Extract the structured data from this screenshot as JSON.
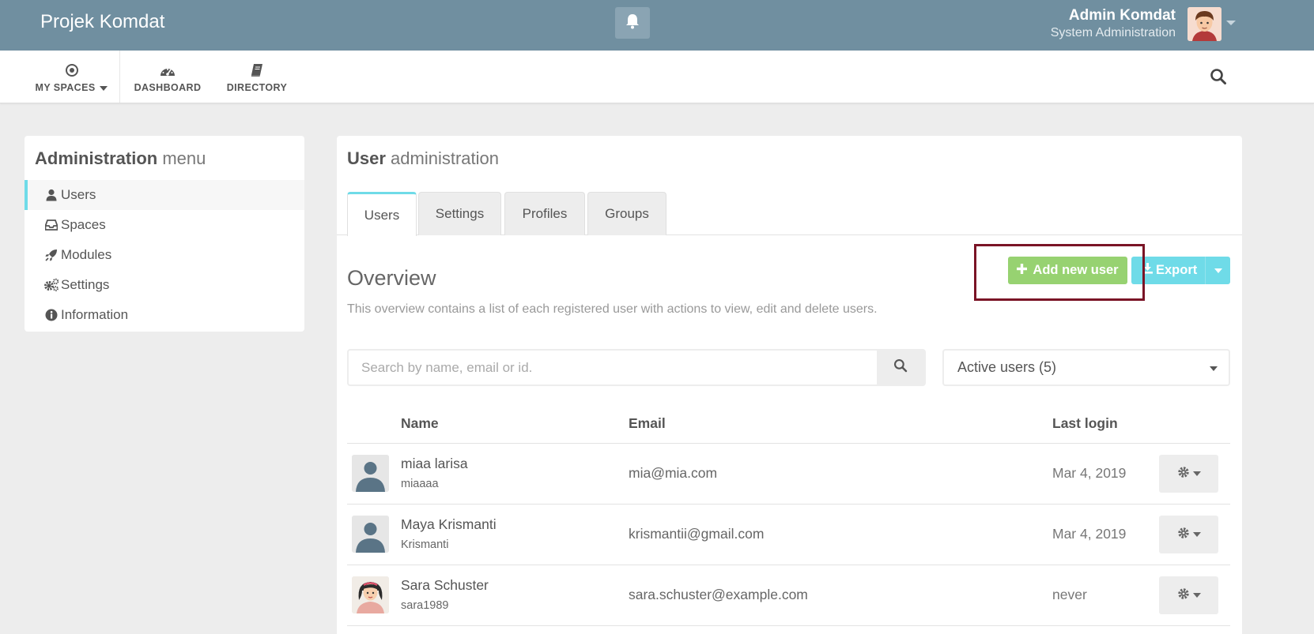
{
  "app": {
    "brand": "Projek Komdat"
  },
  "user": {
    "name": "Admin Komdat",
    "role": "System Administration"
  },
  "nav": {
    "my_spaces": "MY SPACES",
    "dashboard": "DASHBOARD",
    "directory": "DIRECTORY"
  },
  "admin_menu": {
    "title_bold": "Administration",
    "title_light": "menu",
    "items": [
      {
        "label": "Users",
        "icon": "user-icon",
        "active": true
      },
      {
        "label": "Spaces",
        "icon": "inbox-icon"
      },
      {
        "label": "Modules",
        "icon": "rocket-icon"
      },
      {
        "label": "Settings",
        "icon": "gears-icon"
      },
      {
        "label": "Information",
        "icon": "info-circle-icon"
      }
    ]
  },
  "main": {
    "title_bold": "User",
    "title_light": "administration",
    "tabs": [
      {
        "label": "Users",
        "active": true
      },
      {
        "label": "Settings"
      },
      {
        "label": "Profiles"
      },
      {
        "label": "Groups"
      }
    ],
    "overview_title": "Overview",
    "overview_desc": "This overview contains a list of each registered user with actions to view, edit and delete users.",
    "add_button": "Add new user",
    "export_button": "Export",
    "search_placeholder": "Search by name, email or id.",
    "filter_selected": "Active users (5)",
    "columns": {
      "name": "Name",
      "email": "Email",
      "last_login": "Last login"
    },
    "rows": [
      {
        "name": "miaa larisa",
        "username": "miaaaa",
        "email": "mia@mia.com",
        "last_login": "Mar 4, 2019",
        "avatar": "default-avatar-icon"
      },
      {
        "name": "Maya Krismanti",
        "username": "Krismanti",
        "email": "krismantii@gmail.com",
        "last_login": "Mar 4, 2019",
        "avatar": "default-avatar-icon"
      },
      {
        "name": "Sara Schuster",
        "username": "sara1989",
        "email": "sara.schuster@example.com",
        "last_login": "never",
        "avatar": "female-avatar-icon"
      }
    ]
  },
  "colors": {
    "topbar": "#708fa0",
    "accent": "#6fdbe8",
    "success": "#97d271",
    "highlight": "#7a1426"
  }
}
